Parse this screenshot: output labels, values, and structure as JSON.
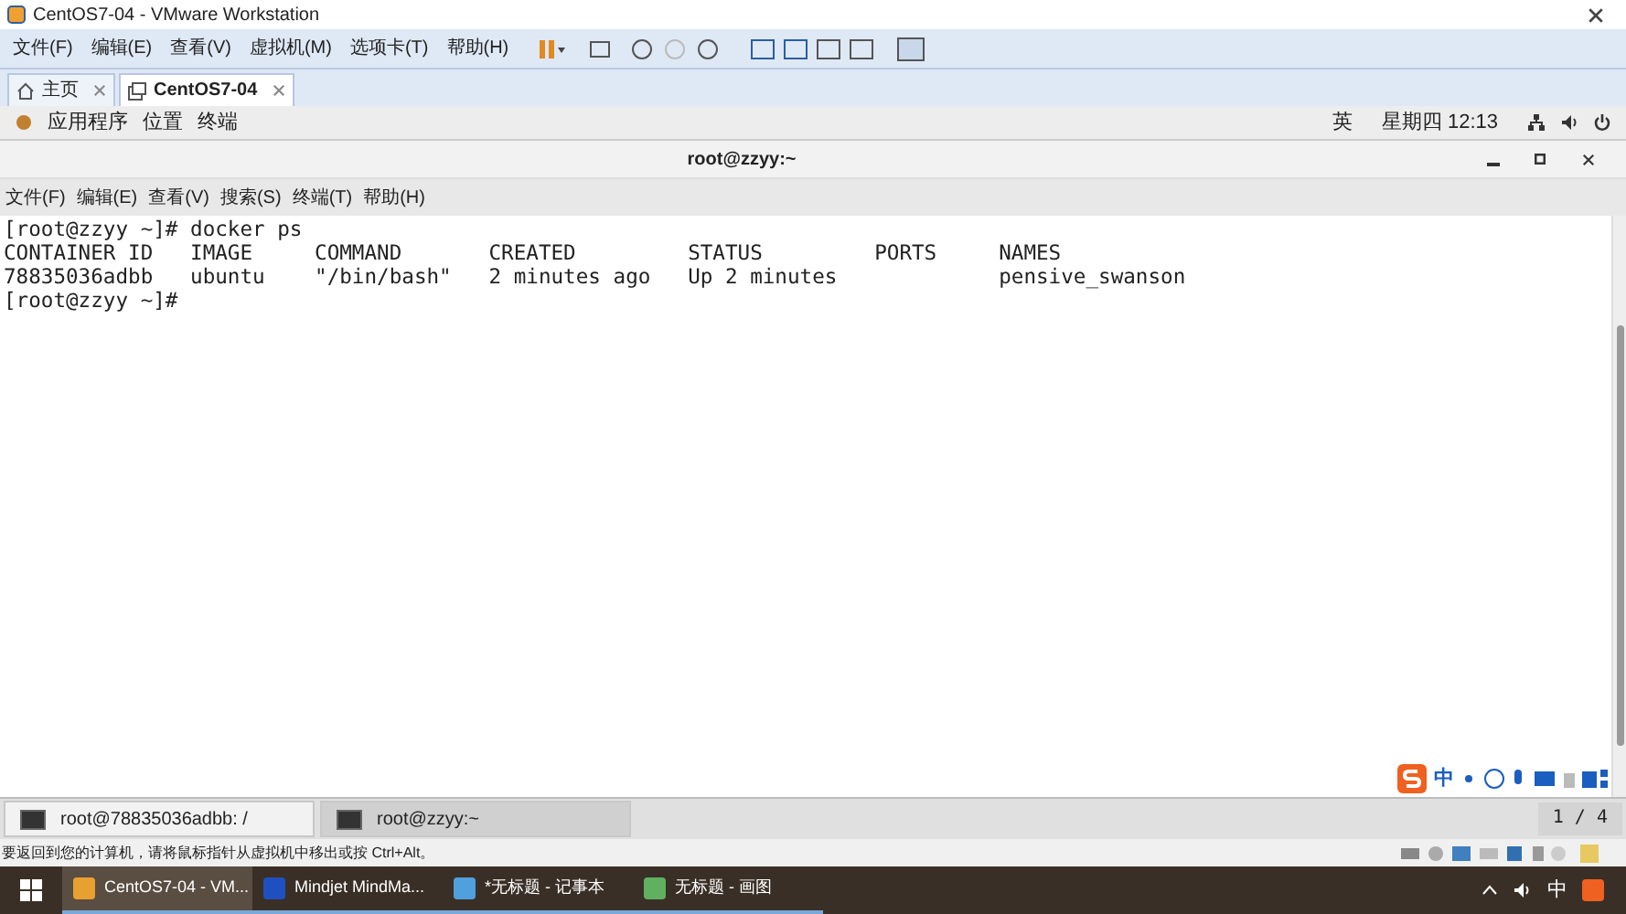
{
  "window": {
    "title": "CentOS7-04 - VMware Workstation"
  },
  "menu": [
    "文件(F)",
    "编辑(E)",
    "查看(V)",
    "虚拟机(M)",
    "选项卡(T)",
    "帮助(H)"
  ],
  "tabs": [
    {
      "label": "主页",
      "kind": "home",
      "selected": false
    },
    {
      "label": "CentOS7-04",
      "kind": "vm",
      "selected": true
    }
  ],
  "gnome_bar": {
    "items": [
      "应用程序",
      "位置",
      "终端"
    ],
    "input_method": "英",
    "clock": "星期四 12:13"
  },
  "terminal": {
    "title": "root@zzyy:~",
    "menu": [
      "文件(F)",
      "编辑(E)",
      "查看(V)",
      "搜索(S)",
      "终端(T)",
      "帮助(H)"
    ],
    "lines": [
      "[root@zzyy ~]# docker ps",
      "CONTAINER ID   IMAGE     COMMAND       CREATED         STATUS         PORTS     NAMES",
      "78835036adbb   ubuntu    \"/bin/bash\"   2 minutes ago   Up 2 minutes             pensive_swanson",
      "[root@zzyy ~]#"
    ]
  },
  "ime_bar": {
    "label": "中"
  },
  "window_list": [
    {
      "label": "root@78835036adbb: /",
      "selected": false
    },
    {
      "label": "root@zzyy:~",
      "selected": true
    }
  ],
  "workspace": "1 / 4",
  "status_bar": "要返回到您的计算机，请将鼠标指针从虚拟机中移出或按 Ctrl+Alt。",
  "taskbar": [
    {
      "label": "CentOS7-04 - VM...",
      "selected": true,
      "color": "#e8a030"
    },
    {
      "label": "Mindjet MindMa...",
      "selected": false,
      "color": "#2050c0"
    },
    {
      "label": "*无标题 - 记事本",
      "selected": false,
      "color": "#50a0e0"
    },
    {
      "label": "无标题 - 画图",
      "selected": false,
      "color": "#60b060"
    }
  ],
  "tray": {
    "ime": "中"
  }
}
